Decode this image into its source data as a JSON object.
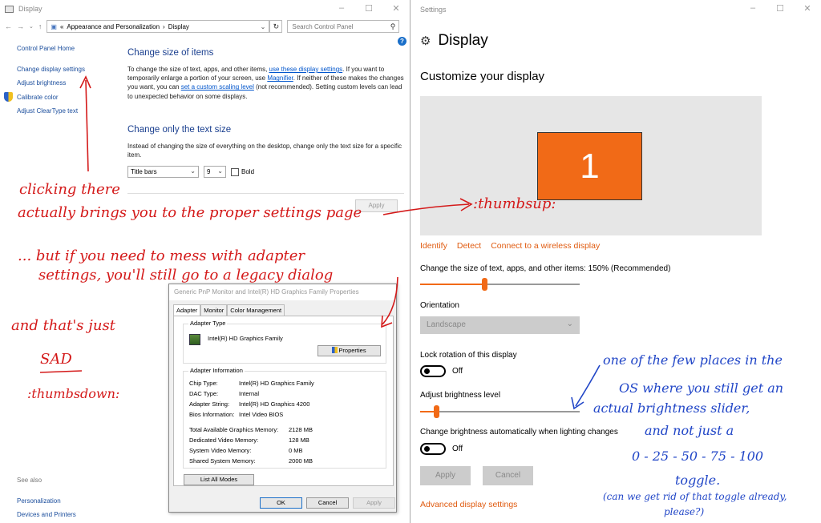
{
  "control_panel": {
    "window_title": "Display",
    "address": {
      "crumb_1": "Appearance and Personalization",
      "crumb_2": "Display",
      "search_placeholder": "Search Control Panel"
    },
    "nav": {
      "home": "Control Panel Home",
      "items": [
        "Change display settings",
        "Adjust brightness",
        "Calibrate color",
        "Adjust ClearType text"
      ]
    },
    "main": {
      "size_heading": "Change size of items",
      "size_text_1": "To change the size of text, apps, and other items, ",
      "size_link_1": "use these display settings",
      "size_text_2": ". If you want to temporarily enlarge a portion of your screen, use ",
      "size_link_2": "Magnifier",
      "size_text_3": ". If neither of these makes the changes you want, you can ",
      "size_link_3": "set a custom scaling level",
      "size_text_4": " (not recommended). Setting custom levels can lead to unexpected behavior on some displays.",
      "text_heading": "Change only the text size",
      "text_desc": "Instead of changing the size of everything on the desktop, change only the text size for a specific item.",
      "item_select": "Title bars",
      "size_select": "9",
      "bold_label": "Bold",
      "apply_label": "Apply"
    },
    "see_also": {
      "heading": "See also",
      "items": [
        "Personalization",
        "Devices and Printers"
      ]
    }
  },
  "dialog": {
    "title": "Generic PnP Monitor and Intel(R) HD Graphics Family Properties",
    "tabs": [
      "Adapter",
      "Monitor",
      "Color Management"
    ],
    "adapter_type_label": "Adapter Type",
    "adapter_name": "Intel(R) HD Graphics Family",
    "properties_button": "Properties",
    "adapter_info_label": "Adapter Information",
    "info": [
      {
        "k": "Chip Type:",
        "v": "Intel(R) HD Graphics Family"
      },
      {
        "k": "DAC Type:",
        "v": "Internal"
      },
      {
        "k": "Adapter String:",
        "v": "Intel(R) HD Graphics 4200"
      },
      {
        "k": "Bios Information:",
        "v": "Intel Video BIOS"
      }
    ],
    "memory": [
      {
        "k": "Total Available Graphics Memory:",
        "v": "2128 MB"
      },
      {
        "k": "Dedicated Video Memory:",
        "v": "128 MB"
      },
      {
        "k": "System Video Memory:",
        "v": "0 MB"
      },
      {
        "k": "Shared System Memory:",
        "v": "2000 MB"
      }
    ],
    "list_modes_button": "List All Modes",
    "ok": "OK",
    "cancel": "Cancel",
    "apply": "Apply"
  },
  "settings": {
    "window_title": "Settings",
    "page_title": "Display",
    "section_title": "Customize your display",
    "monitor_number": "1",
    "links": [
      "Identify",
      "Detect",
      "Connect to a wireless display"
    ],
    "scale_label": "Change the size of text, apps, and other items: 150% (Recommended)",
    "scale_slider_fraction": 0.4,
    "orientation_label": "Orientation",
    "orientation_value": "Landscape",
    "lock_rotation_label": "Lock rotation of this display",
    "lock_rotation_state": "Off",
    "brightness_label": "Adjust brightness level",
    "brightness_fraction": 0.1,
    "auto_brightness_label": "Change brightness automatically when lighting changes",
    "auto_brightness_state": "Off",
    "apply": "Apply",
    "cancel": "Cancel",
    "advanced_link": "Advanced display settings"
  },
  "annotations": {
    "red_1": "clicking there",
    "red_2": "actually brings you to the proper settings page",
    "red_thumbsup": ":thumbsup:",
    "red_3": "... but if you need to mess with adapter",
    "red_4": "settings, you'll still go to a legacy dialog",
    "red_5": "and that's just",
    "red_sad": "SAD",
    "red_thumbsdown": ":thumbsdown:",
    "blue_1": "one of the few places in the",
    "blue_2": "OS where you still get an",
    "blue_3": "actual brightness slider,",
    "blue_4": "and not just a",
    "blue_5": "0 - 25 - 50 - 75 - 100",
    "blue_6": "toggle.",
    "blue_7": "(can we get rid of that toggle already,",
    "blue_8": "please?)",
    "colors": {
      "red": "#d41a1a",
      "blue": "#2146c7",
      "accent": "#f16a17"
    }
  }
}
